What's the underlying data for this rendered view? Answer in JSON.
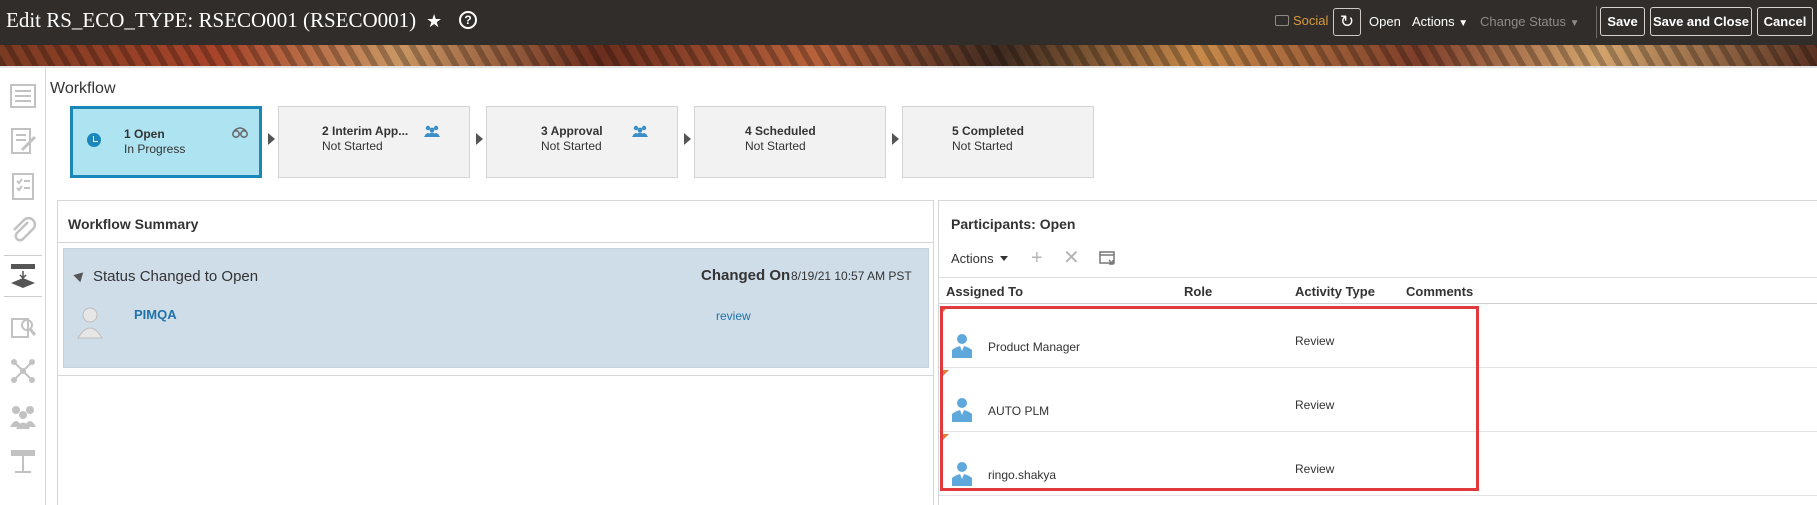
{
  "header": {
    "title": "Edit RS_ECO_TYPE: RSECO001 (RSECO001)",
    "social_label": "Social",
    "status_label": "Open",
    "actions_label": "Actions",
    "change_status_label": "Change Status",
    "save_label": "Save",
    "save_close_label": "Save and Close",
    "cancel_label": "Cancel"
  },
  "workflow": {
    "title": "Workflow",
    "stages": [
      {
        "name": "1 Open",
        "status": "In Progress"
      },
      {
        "name": "2 Interim App...",
        "status": "Not Started"
      },
      {
        "name": "3 Approval",
        "status": "Not Started"
      },
      {
        "name": "4 Scheduled",
        "status": "Not Started"
      },
      {
        "name": "5 Completed",
        "status": "Not Started"
      }
    ]
  },
  "summary": {
    "title": "Workflow Summary",
    "status_text": "Status Changed to Open",
    "changed_on_label": "Changed On",
    "changed_on_value": "8/19/21 10:57 AM PST",
    "user": "PIMQA",
    "activity": "review"
  },
  "participants": {
    "title": "Participants: Open",
    "actions_label": "Actions",
    "columns": [
      "Assigned To",
      "Role",
      "Activity Type",
      "Comments"
    ],
    "rows": [
      {
        "assigned_to": "Product Manager",
        "role": "",
        "activity_type": "Review",
        "comments": ""
      },
      {
        "assigned_to": "AUTO PLM",
        "role": "",
        "activity_type": "Review",
        "comments": ""
      },
      {
        "assigned_to": "ringo.shakya",
        "role": "",
        "activity_type": "Review",
        "comments": ""
      }
    ]
  },
  "colors": {
    "header_bg": "#312d2a",
    "active_stage_bg": "#aee3f2",
    "active_stage_border": "#1a87b8",
    "summary_row_bg": "#cfdde9",
    "link": "#1f73a8",
    "highlight": "#e03a3e",
    "social": "#d99a3a"
  }
}
